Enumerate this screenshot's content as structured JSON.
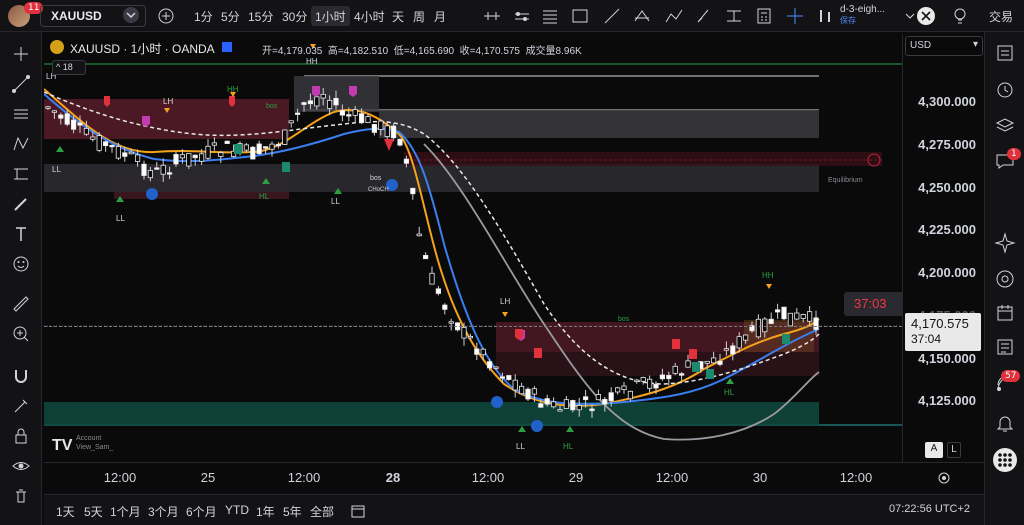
{
  "topbar": {
    "avatar_badge": "11",
    "symbol": "XAUUSD",
    "add_label": "+",
    "timeframes": [
      "1分",
      "5分",
      "15分",
      "30分",
      "1小时",
      "4小时",
      "天",
      "周",
      "月"
    ],
    "active_timeframe": "1小时",
    "layout_name": "d-3-eigh...",
    "layout_sub": "保存",
    "trade_label": "交易"
  },
  "legend": {
    "title": "XAUUSD · 1小时 · OANDA",
    "open": "开=4,179.035",
    "high": "高=4,182.510",
    "low": "低=4,165.690",
    "close": "收=4,170.575",
    "volume": "成交量8.96K",
    "collapse_count": "18"
  },
  "price_axis": {
    "currency": "USD",
    "ticks": [
      "4,300.000",
      "4,275.000",
      "4,250.000",
      "4,225.000",
      "4,200.000",
      "4,150.000",
      "4,125.000"
    ],
    "current_price": "4,170.575",
    "countdown": "37:04",
    "alert_countdown": "37:03",
    "partial_tick": "4,175.000"
  },
  "time_axis": {
    "ticks": [
      "12:00",
      "25",
      "12:00",
      "28",
      "12:00",
      "29",
      "12:00",
      "30",
      "12:00"
    ]
  },
  "chart_labels": {
    "equilibrium": "Equilibrium",
    "bos1": "bos",
    "bos2": "bos",
    "bos3": "bos",
    "chochm": "CHoCH",
    "hh1": "HH",
    "hh2": "HH",
    "hh3": "HH",
    "lh1": "LH",
    "lh2": "LH",
    "lh3": "LH",
    "ll1": "LL",
    "ll2": "LL",
    "ll3": "LL",
    "ll4": "LL",
    "hl1": "HL",
    "hl2": "HL",
    "hl3": "HL",
    "watermark": "Account\nView_Sam_"
  },
  "bottombar": {
    "ranges": [
      "1天",
      "5天",
      "1个月",
      "3个月",
      "6个月",
      "YTD",
      "1年",
      "5年",
      "全部"
    ],
    "clock": "07:22:56 UTC+2",
    "auto_label": "A",
    "log_label": "L"
  },
  "rsidebar": {
    "chat_badge": "1",
    "feed_badge": "57"
  },
  "colors": {
    "bull": "#e8e8e8",
    "bear": "#e8e8e8",
    "ema_orange": "#f7a21b",
    "ema_blue": "#3b7ef0",
    "ema_gray": "#a0a0a5",
    "red_zone": "#8c2233",
    "green_zone": "#0f5a4a",
    "accent_red": "#e0313d"
  }
}
